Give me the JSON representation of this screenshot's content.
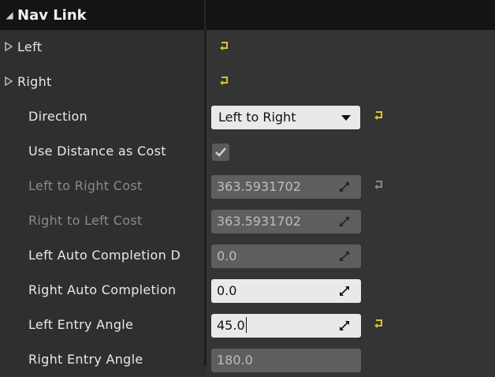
{
  "header": {
    "title": "Nav Link"
  },
  "rows": {
    "left": {
      "label": "Left"
    },
    "right": {
      "label": "Right"
    },
    "direction": {
      "label": "Direction",
      "value": "Left to Right"
    },
    "use_distance": {
      "label": "Use Distance as Cost",
      "checked": true
    },
    "l2r_cost": {
      "label": "Left to Right Cost",
      "value": "363.5931702"
    },
    "r2l_cost": {
      "label": "Right to Left Cost",
      "value": "363.5931702"
    },
    "left_auto": {
      "label": "Left Auto Completion D",
      "value": "0.0"
    },
    "right_auto": {
      "label": "Right Auto Completion",
      "value": "0.0"
    },
    "left_entry": {
      "label": "Left Entry Angle",
      "value": "45.0"
    },
    "right_entry": {
      "label": "Right Entry Angle",
      "value": "180.0"
    }
  },
  "colors": {
    "reset_arrow": "#d8c425",
    "background": "#2f2f2f",
    "header": "#141414"
  }
}
